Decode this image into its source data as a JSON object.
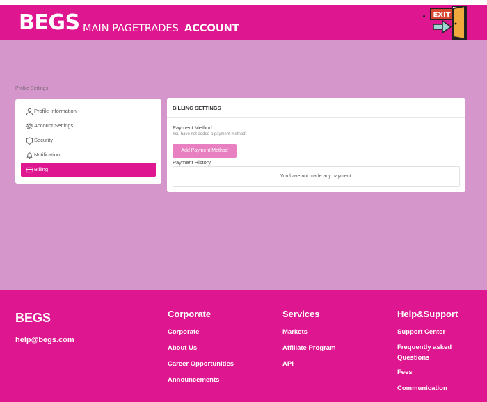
{
  "header": {
    "brand": "BEGS",
    "nav": [
      "MAIN PAGE",
      "TRADES",
      "ACCOUNT"
    ],
    "exit_label": "EXIT",
    "accent": "#de1690"
  },
  "breadcrumb": "Profile Settings",
  "sidebar": {
    "items": [
      {
        "label": "Profile Information",
        "icon": "user-icon"
      },
      {
        "label": "Account Settings",
        "icon": "gear-icon"
      },
      {
        "label": "Security",
        "icon": "shield-icon"
      },
      {
        "label": "Notification",
        "icon": "bell-icon"
      },
      {
        "label": "Billing",
        "icon": "credit-card-icon",
        "active": true
      }
    ]
  },
  "billing": {
    "title": "BILLING SETTINGS",
    "payment_method_label": "Payment Method",
    "payment_method_empty": "You have not added a payment method",
    "add_button": "Add Payment Method",
    "payment_history_label": "Payment History",
    "payment_history_empty": "You have not made any payment."
  },
  "footer": {
    "brand": "BEGS",
    "email": "help@begs.com",
    "columns": [
      {
        "title": "Corporate",
        "links": [
          "Corporate",
          "About Us",
          "Career Opportunities",
          "Announcements"
        ]
      },
      {
        "title": "Services",
        "links": [
          "Markets",
          "Affiliate Program",
          "API"
        ]
      },
      {
        "title": "Help&Support",
        "links": [
          "Support Center",
          "Frequently asked Questions",
          "Fees",
          "Communication"
        ]
      }
    ]
  },
  "colors": {
    "background": "#d597cb",
    "accent": "#de1690",
    "button": "#e77fc0"
  }
}
